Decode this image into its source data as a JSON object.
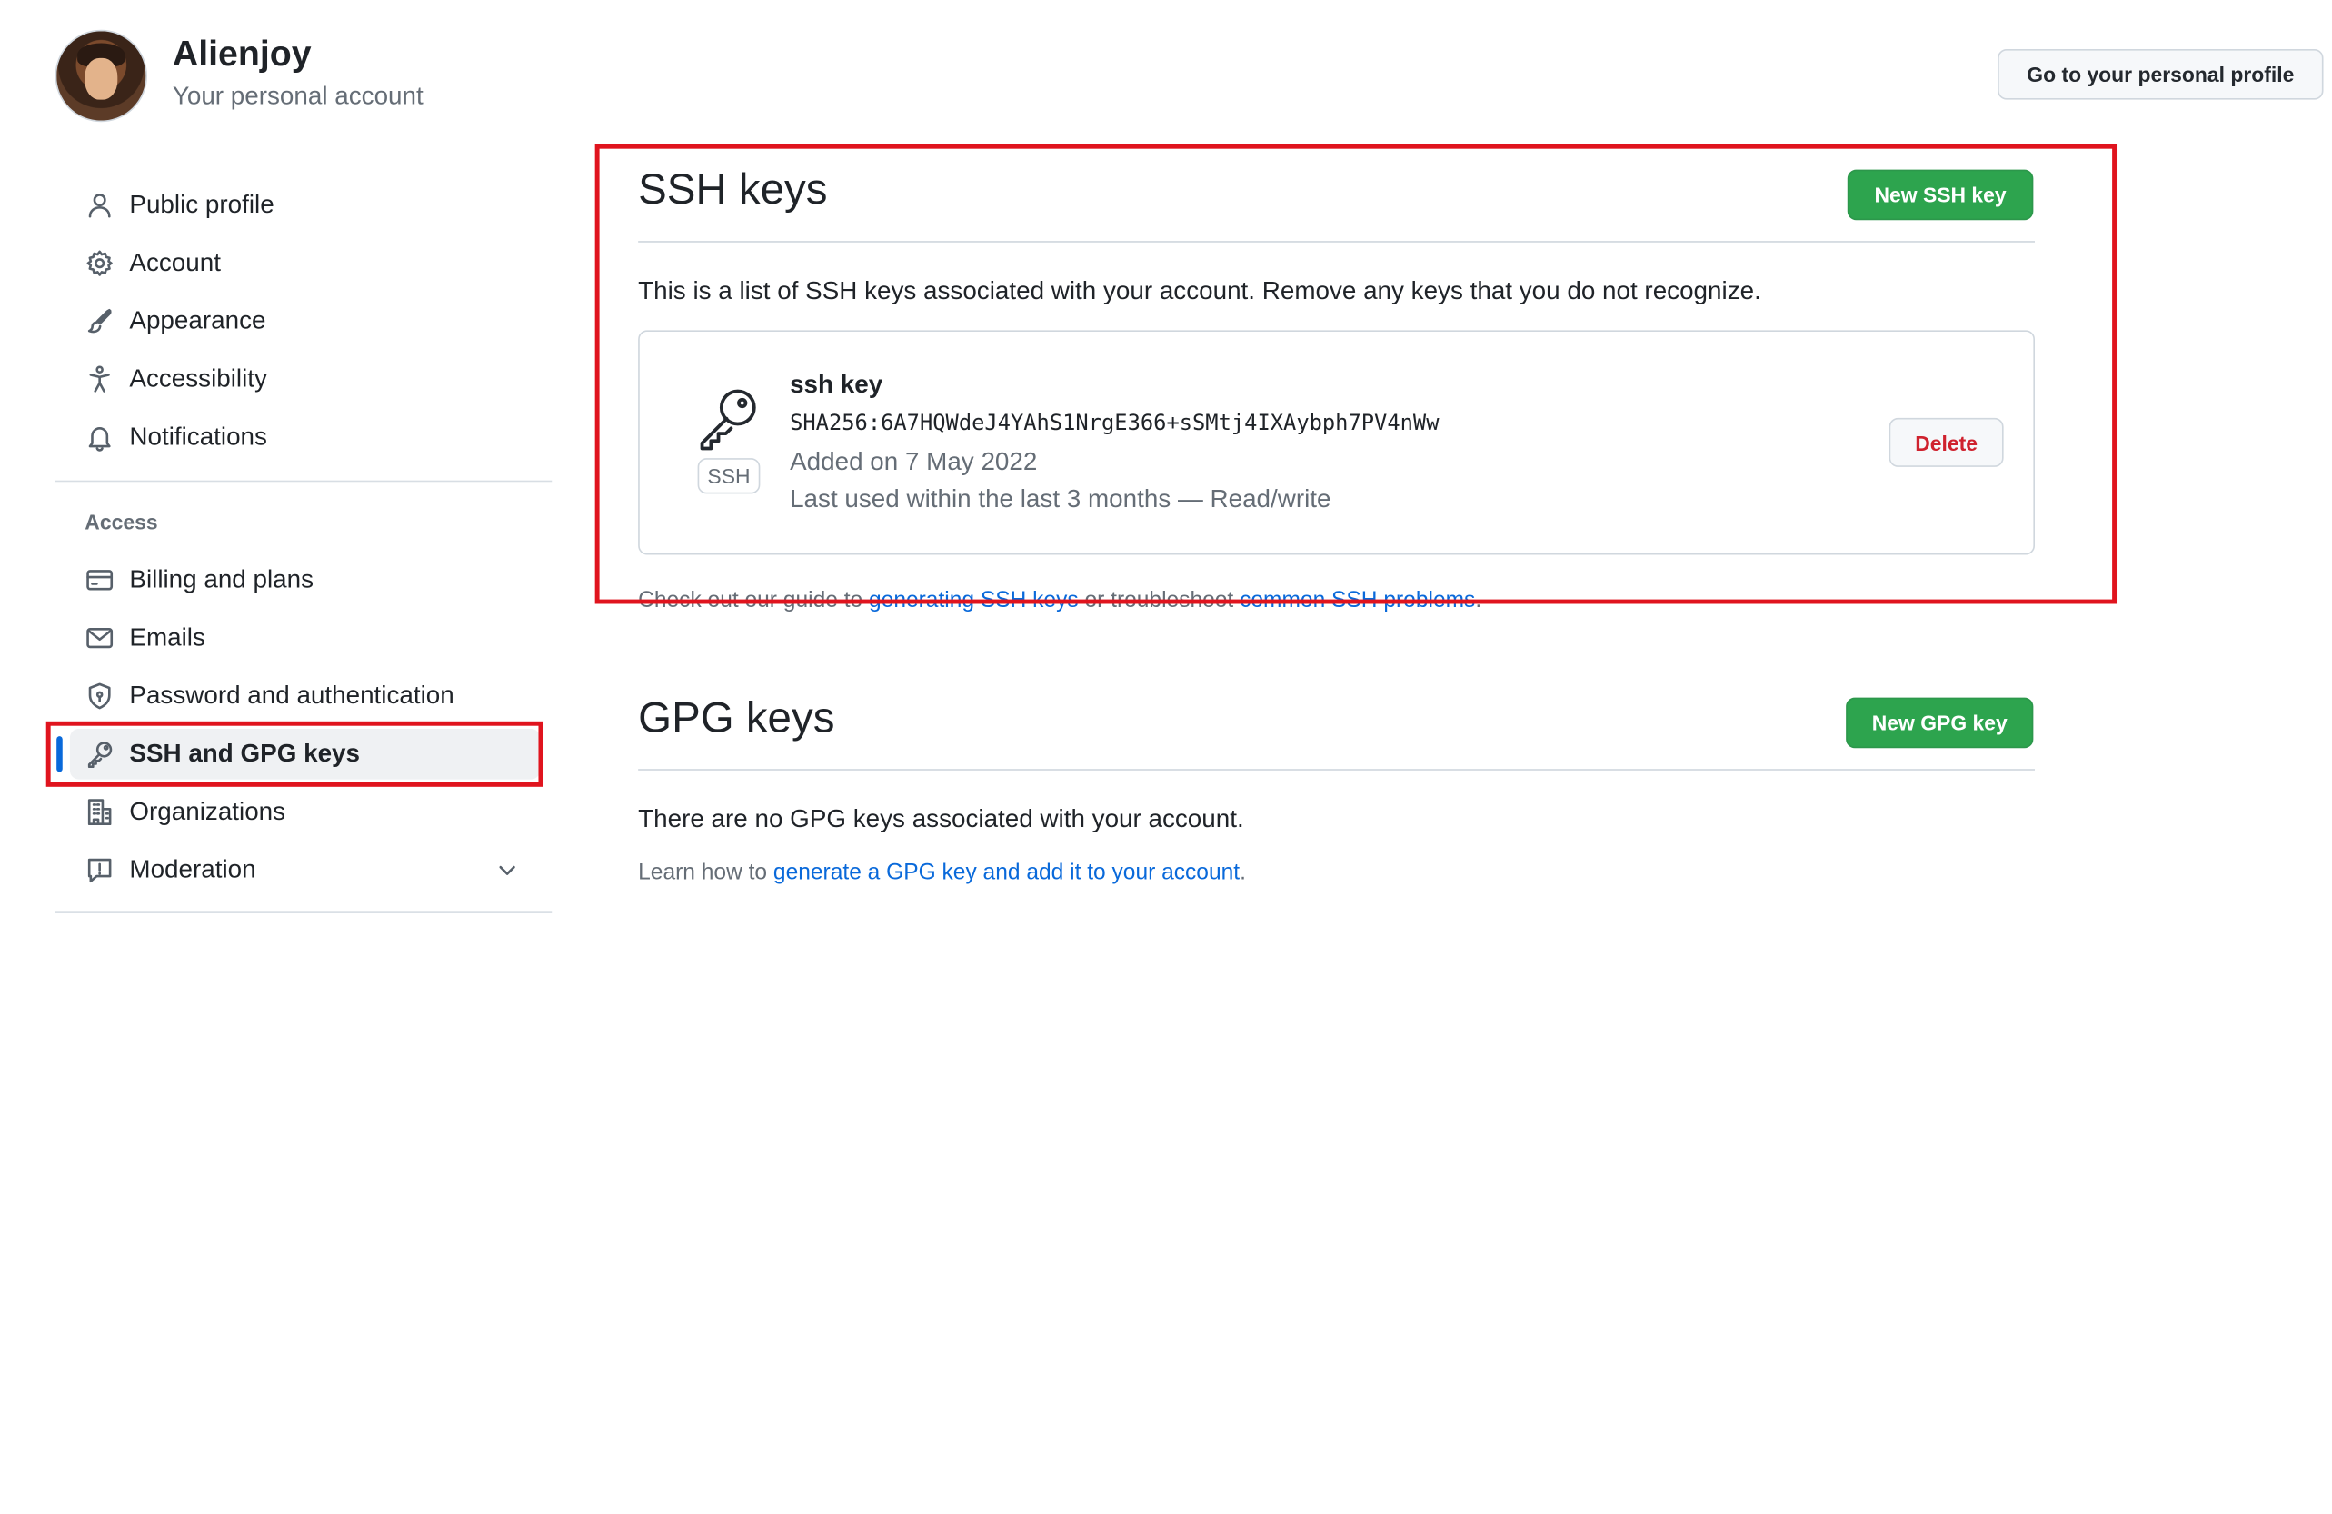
{
  "header": {
    "user_name": "Alienjoy",
    "user_subtitle": "Your personal account",
    "profile_button": "Go to your personal profile"
  },
  "sidebar": {
    "items": [
      {
        "label": "Public profile",
        "icon": "person-icon"
      },
      {
        "label": "Account",
        "icon": "gear-icon"
      },
      {
        "label": "Appearance",
        "icon": "paintbrush-icon"
      },
      {
        "label": "Accessibility",
        "icon": "accessibility-icon"
      },
      {
        "label": "Notifications",
        "icon": "bell-icon"
      }
    ],
    "access_heading": "Access",
    "access_items": [
      {
        "label": "Billing and plans",
        "icon": "credit-card-icon"
      },
      {
        "label": "Emails",
        "icon": "mail-icon"
      },
      {
        "label": "Password and authentication",
        "icon": "shield-lock-icon"
      },
      {
        "label": "SSH and GPG keys",
        "icon": "key-icon",
        "active": true
      },
      {
        "label": "Organizations",
        "icon": "organization-icon"
      },
      {
        "label": "Moderation",
        "icon": "report-icon"
      }
    ]
  },
  "ssh": {
    "title": "SSH keys",
    "new_button": "New SSH key",
    "description": "This is a list of SSH keys associated with your account. Remove any keys that you do not recognize.",
    "key": {
      "title": "ssh key",
      "badge": "SSH",
      "fingerprint": "SHA256:6A7HQWdeJ4YAhS1NrgE366+sSMtj4IXAybph7PV4nWw",
      "added": "Added on 7 May 2022",
      "last_used": "Last used within the last 3 months — Read/write",
      "delete_button": "Delete"
    },
    "guide_prefix": "Check out our guide to ",
    "guide_link1": "generating SSH keys",
    "guide_middle": " or troubleshoot ",
    "guide_link2": "common SSH problems",
    "guide_suffix": "."
  },
  "gpg": {
    "title": "GPG keys",
    "new_button": "New GPG key",
    "empty_text": "There are no GPG keys associated with your account.",
    "learn_prefix": "Learn how to ",
    "learn_link": "generate a GPG key and add it to your account",
    "learn_suffix": "."
  },
  "colors": {
    "accent": "#0969da",
    "primary_button": "#2da44e",
    "danger": "#cf222e",
    "highlight_box": "#e0141e"
  }
}
